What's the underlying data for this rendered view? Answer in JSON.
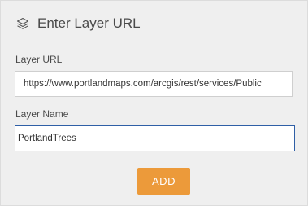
{
  "dialog": {
    "title": "Enter Layer URL",
    "header_icon": "layers-icon"
  },
  "form": {
    "url_label": "Layer URL",
    "url_value": "https://www.portlandmaps.com/arcgis/rest/services/Public",
    "name_label": "Layer Name",
    "name_value": "PortlandTrees"
  },
  "actions": {
    "add_label": "ADD"
  },
  "colors": {
    "panel_bg": "#efefef",
    "accent_button": "#ec9a3a",
    "focus_border": "#2f5fa6",
    "text": "#4a4a4a"
  }
}
